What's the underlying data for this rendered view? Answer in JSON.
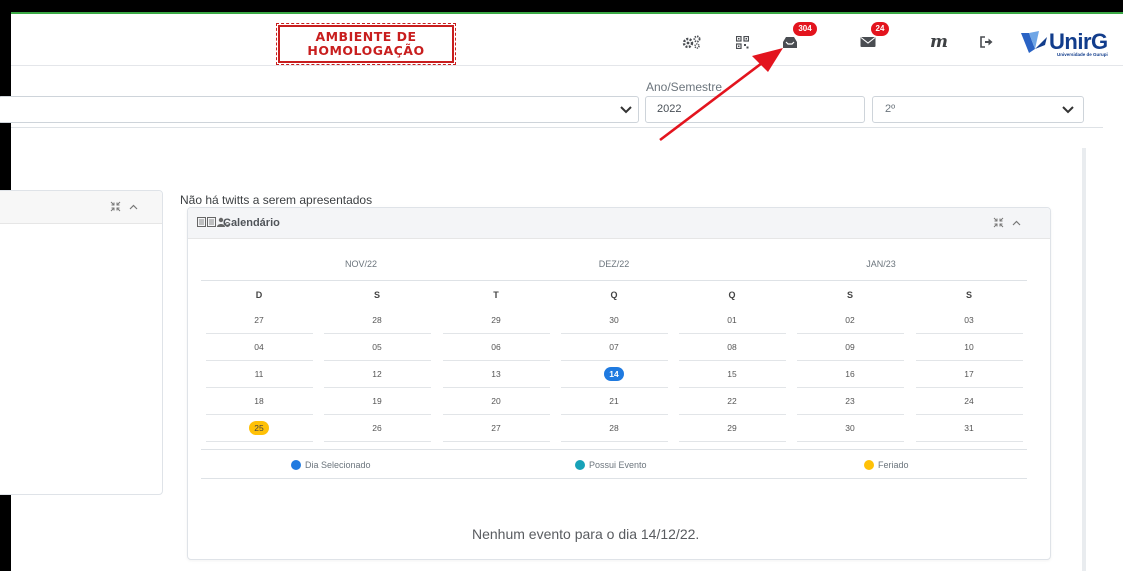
{
  "header": {
    "stamp_line1": "AMBIENTE DE",
    "stamp_line2": "HOMOLOGAÇÃO",
    "icons": [
      "gears-icon",
      "qrcode-icon",
      "inbox-icon",
      "mail-icon",
      "m-icon",
      "logout-icon"
    ],
    "inbox_badge": "304",
    "mail_badge": "24",
    "m_label": "m",
    "logo_text": "UnirG",
    "logo_subtext": "Universidade de Gurupi"
  },
  "filters": {
    "ano_semestre_label": "Ano/Semestre",
    "year_value": "2022",
    "semester_value": "2º"
  },
  "twitts_message": "Não há twitts a serem apresentados",
  "calendar": {
    "title": "Calendário",
    "months": [
      "NOV/22",
      "DEZ/22",
      "JAN/23"
    ],
    "weekdays": [
      "D",
      "S",
      "T",
      "Q",
      "Q",
      "S",
      "S"
    ],
    "weeks": [
      [
        "27",
        "28",
        "29",
        "30",
        "01",
        "02",
        "03"
      ],
      [
        "04",
        "05",
        "06",
        "07",
        "08",
        "09",
        "10"
      ],
      [
        "11",
        "12",
        "13",
        "14",
        "15",
        "16",
        "17"
      ],
      [
        "18",
        "19",
        "20",
        "21",
        "22",
        "23",
        "24"
      ],
      [
        "25",
        "26",
        "27",
        "28",
        "29",
        "30",
        "31"
      ]
    ],
    "selected_day": "14",
    "holiday_day": "25",
    "legend": [
      {
        "label": "Dia Selecionado",
        "color": "#1f7ae0"
      },
      {
        "label": "Possui Evento",
        "color": "#17a2b8"
      },
      {
        "label": "Feriado",
        "color": "#ffc107"
      }
    ],
    "no_event_message": "Nenhum evento para o dia 14/12/22."
  },
  "colors": {
    "stamp_red": "#c81e1e",
    "badge_red": "#e3141e",
    "brand_blue": "#123d8c",
    "selected_blue": "#1f7ae0",
    "holiday_yellow": "#ffc107",
    "annotation_arrow": "#e3141e"
  }
}
